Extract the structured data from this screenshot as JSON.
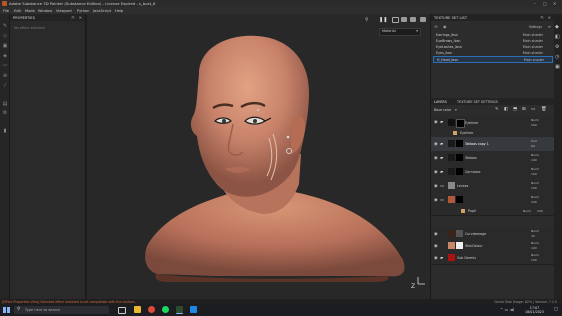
{
  "window": {
    "title": "Adobe Substance 3D Painter (Substance Edition) - License Expired - s_bust_6"
  },
  "menu": [
    "File",
    "Edit",
    "Mode",
    "Window",
    "Viewport",
    "Python",
    "JavaScript",
    "Help"
  ],
  "properties": {
    "title": "PROPERTIES",
    "placeholder": "No effect selected"
  },
  "viewport": {
    "display_mode": "Material"
  },
  "texture_set_list": {
    "title": "TEXTURE SET LIST",
    "settings_label": "Settings",
    "rows": [
      {
        "name": "Earrings_lbsn",
        "shader": "Main shader"
      },
      {
        "name": "EyeBrows_lbsn",
        "shader": "Main shader"
      },
      {
        "name": "EyeLashes_lbsn",
        "shader": "Main shader"
      },
      {
        "name": "Eyes_lbsn",
        "shader": "Main shader"
      },
      {
        "name": "H_Head_lbsn",
        "shader": "Main shader"
      }
    ]
  },
  "layers_panel": {
    "tab_layers": "LAYERS",
    "tab_tss": "TEXTURE SET SETTINGS",
    "channel": "Base color",
    "layers": [
      {
        "name": "Eyeliner",
        "blend": "Norm",
        "opacity": "100",
        "type": "folder"
      },
      {
        "name": "Eyeliner",
        "blend": "",
        "opacity": "",
        "type": "sub"
      },
      {
        "name": "Tattoos copy 1",
        "blend": "Ovrl",
        "opacity": "64",
        "type": "folder"
      },
      {
        "name": "Tattoos",
        "blend": "Norm",
        "opacity": "100",
        "type": "folder"
      },
      {
        "name": "Cornrows",
        "blend": "Norm",
        "opacity": "100",
        "type": "folder"
      },
      {
        "name": "Lenses",
        "blend": "Norm",
        "opacity": "100",
        "type": "folder"
      },
      {
        "name": "",
        "blend": "Norm",
        "opacity": "100",
        "type": "folder"
      },
      {
        "name": "Pupil",
        "blend": "Norm",
        "opacity": "100",
        "type": "sub"
      },
      {
        "name": "Curvdamage",
        "blend": "Norm",
        "opacity": "35",
        "type": "fill"
      },
      {
        "name": "SkinColour",
        "blend": "Norm",
        "opacity": "100",
        "type": "fill"
      },
      {
        "name": "Sub Dermis",
        "blend": "Norm",
        "opacity": "100",
        "type": "folder"
      }
    ]
  },
  "status": {
    "message": "[Effect Properties View] Selected effect selected is not compatible with the content.",
    "version": "Cache Disk Usage: 62% | Version: 7.2.0"
  },
  "taskbar": {
    "search_placeholder": "Type here to search",
    "time": "17:07",
    "date": "18/01/2023"
  },
  "colors": {
    "accent": "#2d6fb7",
    "warning": "#d06a3a",
    "skin": "#c98666"
  }
}
